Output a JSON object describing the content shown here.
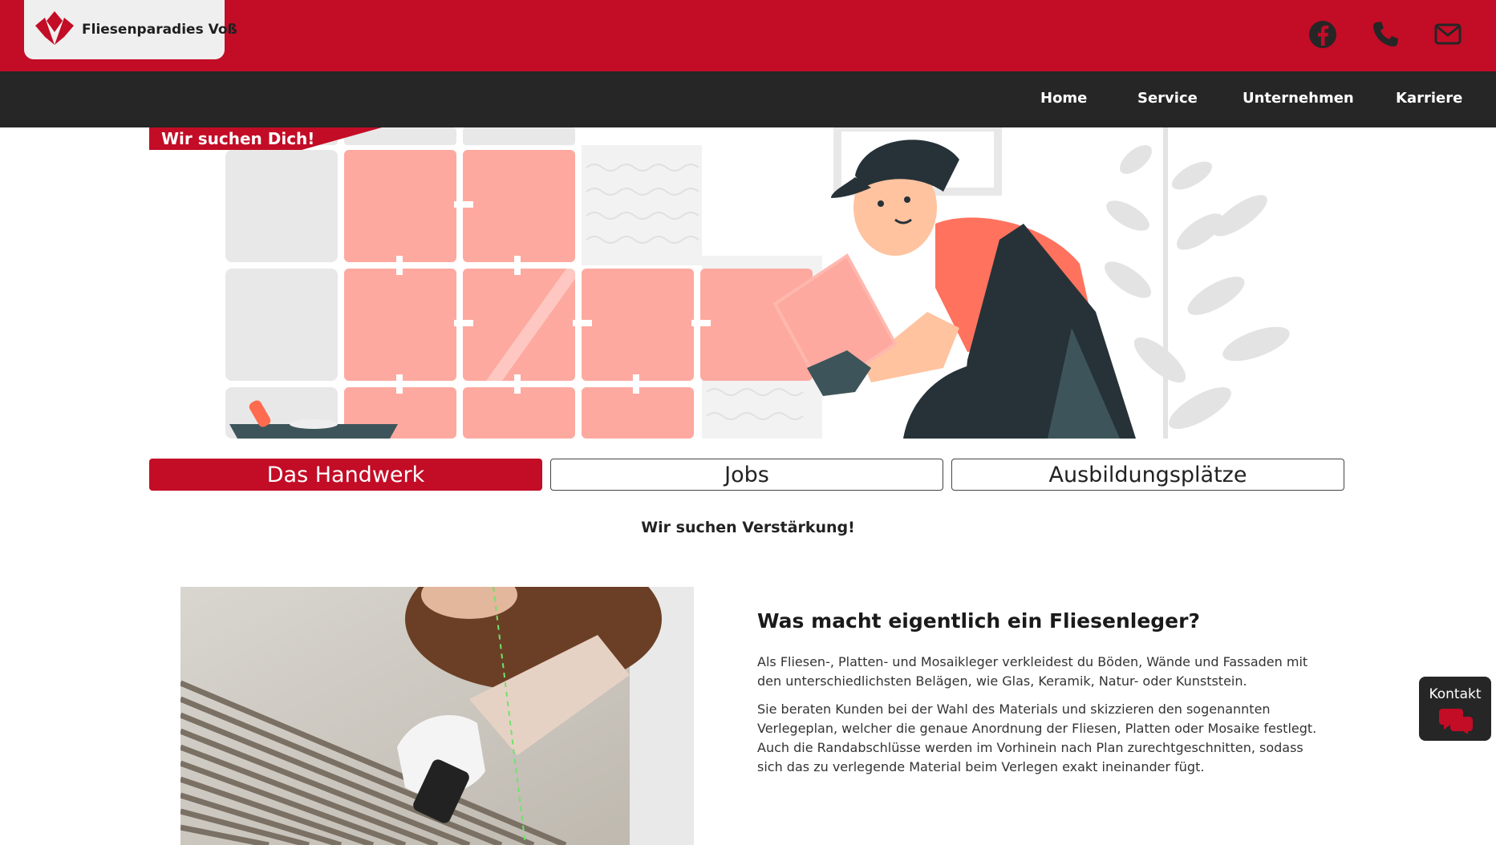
{
  "header": {
    "brand_name": "Fliesenparadies Voß",
    "social_icons": [
      "facebook-icon",
      "phone-icon",
      "mail-icon"
    ],
    "accent_color": "#c30c26",
    "nav_background": "#262626"
  },
  "nav": {
    "items": [
      {
        "label": "Home"
      },
      {
        "label": "Service"
      },
      {
        "label": "Unternehmen"
      },
      {
        "label": "Karriere"
      }
    ]
  },
  "hero": {
    "ribbon_text": "Wir suchen Dich!"
  },
  "tabs": [
    {
      "label": "Das Handwerk",
      "active": true
    },
    {
      "label": "Jobs",
      "active": false
    },
    {
      "label": "Ausbildungsplätze",
      "active": false
    }
  ],
  "section": {
    "subheading": "Wir suchen Verstärkung!"
  },
  "article": {
    "title": "Was macht eigentlich ein Fliesenleger?",
    "paragraph_1": "Als Fliesen-, Platten- und Mosaikleger verkleidest du Böden, Wände und Fassaden mit den unterschiedlichsten Belägen, wie Glas, Keramik, Natur- oder Kunststein.",
    "paragraph_2": "Sie beraten Kunden bei der Wahl des Materials und skizzieren den sogenannten Verlegeplan, welcher die genaue Anordnung der Fliesen, Platten oder Mosaike festlegt. Auch die Randabschlüsse werden im Vorhinein nach Plan zurechtgeschnitten, sodass sich das zu verlegende Material beim Verlegen exakt ineinander fügt."
  },
  "contact": {
    "label": "Kontakt",
    "icon": "chat-icon"
  }
}
